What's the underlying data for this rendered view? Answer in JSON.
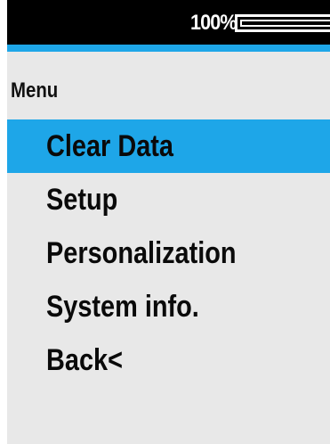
{
  "status_bar": {
    "battery_percent_text": "100%",
    "battery_level": 1.0
  },
  "menu": {
    "heading": "Menu",
    "items": [
      {
        "label": "Clear Data",
        "selected": true
      },
      {
        "label": "Setup",
        "selected": false
      },
      {
        "label": "Personalization",
        "selected": false
      },
      {
        "label": "System info.",
        "selected": false
      },
      {
        "label": "Back<",
        "selected": false
      }
    ]
  },
  "colors": {
    "accent": "#1ea6e8",
    "status_bar_bg": "#000000",
    "screen_bg": "#e8e8e8",
    "text": "#0a0a0a"
  }
}
